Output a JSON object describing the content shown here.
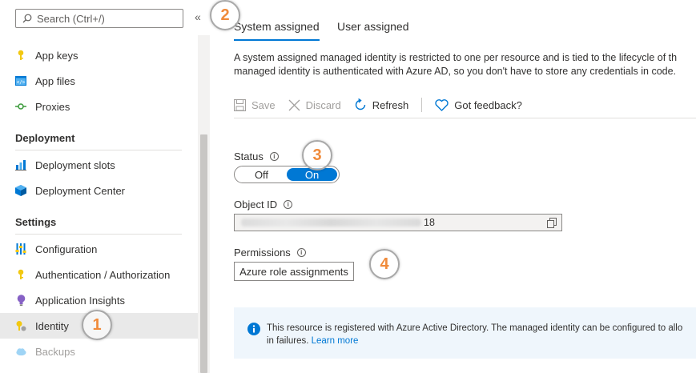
{
  "sidebar": {
    "search_placeholder": "Search (Ctrl+/)",
    "collapse_glyph": "«",
    "items_top": [
      {
        "label": "App keys",
        "icon": "key-icon"
      },
      {
        "label": "App files",
        "icon": "code-file-icon"
      },
      {
        "label": "Proxies",
        "icon": "proxy-icon"
      }
    ],
    "group_deployment": "Deployment",
    "items_deployment": [
      {
        "label": "Deployment slots",
        "icon": "deployment-slots-icon"
      },
      {
        "label": "Deployment Center",
        "icon": "cube-icon"
      }
    ],
    "group_settings": "Settings",
    "items_settings": [
      {
        "label": "Configuration",
        "icon": "sliders-icon"
      },
      {
        "label": "Authentication / Authorization",
        "icon": "key-icon"
      },
      {
        "label": "Application Insights",
        "icon": "lightbulb-icon"
      },
      {
        "label": "Identity",
        "icon": "identity-key-icon",
        "selected": true
      },
      {
        "label": "Backups",
        "icon": "cloud-icon",
        "disabled": true
      }
    ]
  },
  "badges": [
    "1",
    "2",
    "3",
    "4"
  ],
  "tabs": [
    {
      "label": "System assigned",
      "active": true
    },
    {
      "label": "User assigned",
      "active": false
    }
  ],
  "description": {
    "line1": "A system assigned managed identity is restricted to one per resource and is tied to the lifecycle of th",
    "line2": "managed identity is authenticated with Azure AD, so you don't have to store any credentials in code."
  },
  "toolbar": {
    "save": "Save",
    "discard": "Discard",
    "refresh": "Refresh",
    "feedback": "Got feedback?"
  },
  "status": {
    "label": "Status",
    "off": "Off",
    "on": "On",
    "value": "On"
  },
  "object_id": {
    "label": "Object ID",
    "visible_suffix": "18"
  },
  "permissions": {
    "label": "Permissions",
    "button": "Azure role assignments"
  },
  "banner": {
    "text1": "This resource is registered with Azure Active Directory. The managed identity can be configured to allo",
    "text2": "in failures.",
    "link": "Learn more"
  },
  "colors": {
    "accent": "#0078d4",
    "badge_number": "#f08b3b",
    "banner_bg": "#eff6fc",
    "selected_bg": "#e9e9e9"
  }
}
